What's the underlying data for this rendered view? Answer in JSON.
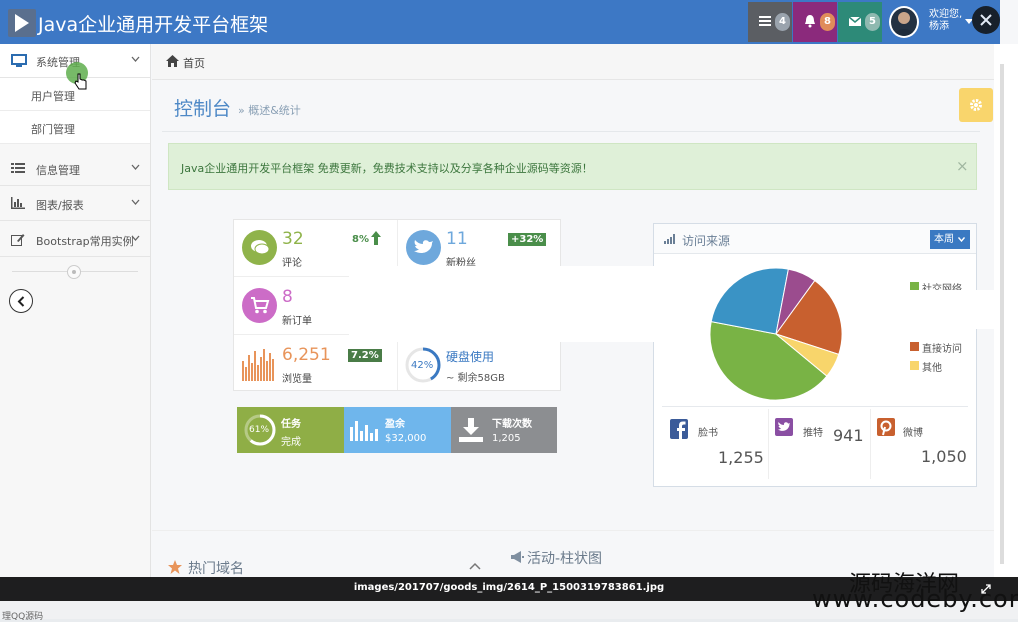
{
  "header": {
    "title": "Java企业通用开发平台框架",
    "badges": [
      "4",
      "8",
      "5"
    ],
    "welcome": "欢迎您,",
    "user": "杨添"
  },
  "sidebar": {
    "items": [
      {
        "label": "系统管理",
        "icon": "desktop-icon"
      },
      {
        "label": "信息管理",
        "icon": "list-icon"
      },
      {
        "label": "图表/报表",
        "icon": "bar-chart-icon"
      },
      {
        "label": "Bootstrap常用实例",
        "icon": "edit-icon"
      }
    ],
    "subitems": [
      "用户管理",
      "部门管理"
    ]
  },
  "breadcrumb": {
    "home": "首页"
  },
  "page": {
    "title": "控制台",
    "subtitle": "» 概述&统计"
  },
  "alert": {
    "text": "Java企业通用开发平台框架 免费更新，免费技术支持以及分享各种企业源码等资源！",
    "close": "×"
  },
  "stats": {
    "comments": {
      "value": "32",
      "label": "评论",
      "pct": "8%"
    },
    "followers": {
      "value": "11",
      "label": "新粉丝",
      "pct": "+32%"
    },
    "orders": {
      "value": "8",
      "label": "新订单"
    },
    "views": {
      "value": "6,251",
      "label": "浏览量",
      "pct": "7.2%"
    },
    "disk": {
      "percent": "42%",
      "label": "硬盘使用",
      "sub": "~ 剩余58GB"
    }
  },
  "tiles": {
    "tasks": {
      "percent": "61%",
      "title": "任务",
      "sub": "完成"
    },
    "balance": {
      "title": "盈余",
      "sub": "$32,000"
    },
    "downloads": {
      "title": "下载次数",
      "sub": "1,205"
    }
  },
  "traffic": {
    "title": "访问来源",
    "period": "本周",
    "legend": [
      {
        "label": "社交网络",
        "color": "#79b345"
      },
      {
        "label": "直接访问",
        "color": "#c8602f"
      },
      {
        "label": "其他",
        "color": "#f8d56b"
      }
    ],
    "social": [
      {
        "name": "脸书",
        "value": "1,255",
        "icon": "facebook-icon"
      },
      {
        "name": "推特",
        "value": "941",
        "icon": "twitter-icon"
      },
      {
        "name": "微博",
        "value": "1,050",
        "icon": "pinterest-icon"
      }
    ]
  },
  "bottom": {
    "hot_domains": "热门域名",
    "activity": "活动-柱状图"
  },
  "overlay": {
    "caption": "images/201707/goods_img/2614_P_1500319783861.jpg",
    "watermark_cn": "源码海洋网",
    "watermark_url": "www.codeby.com",
    "qq_text": "理QQ源码"
  },
  "chart_data": {
    "type": "pie",
    "values": [
      42,
      25,
      20,
      7,
      6
    ],
    "colors": [
      "#79b345",
      "#3a93c5",
      "#c8602f",
      "#9b4c8e",
      "#f8d56b"
    ]
  }
}
